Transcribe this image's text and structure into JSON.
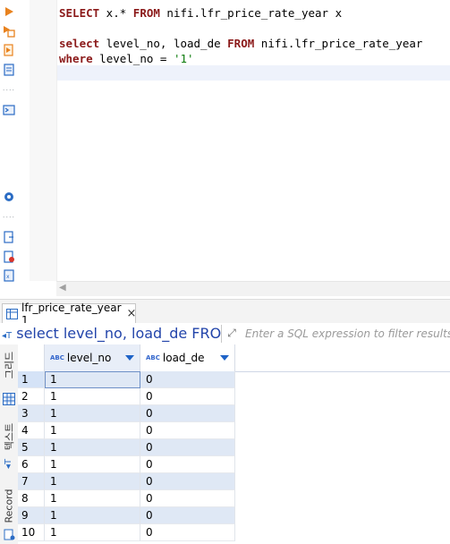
{
  "editor": {
    "lines": [
      [
        {
          "t": "SELECT",
          "k": "kw"
        },
        {
          "t": " x.* ",
          "k": ""
        },
        {
          "t": "FROM",
          "k": "kw"
        },
        {
          "t": " nifi.lfr_price_rate_year x",
          "k": ""
        }
      ],
      [],
      [
        {
          "t": "select",
          "k": "kw"
        },
        {
          "t": " level_no, load_de ",
          "k": ""
        },
        {
          "t": "FROM",
          "k": "kw"
        },
        {
          "t": " nifi.lfr_price_rate_year",
          "k": ""
        }
      ],
      [
        {
          "t": "where",
          "k": "kw"
        },
        {
          "t": " level_no = ",
          "k": ""
        },
        {
          "t": "'1'",
          "k": "str"
        }
      ],
      []
    ]
  },
  "results": {
    "tab_label": "lfr_price_rate_year 1",
    "close_glyph": "×",
    "filter_query": "select level_no, load_de FROM nifi.lfr_pric",
    "filter_placeholder": "Enter a SQL expression to filter results (use",
    "vertical_tabs": {
      "grid": "그리드",
      "text": "텍스트",
      "record": "Record"
    },
    "columns": [
      {
        "type_badge": "ABC",
        "name": "level_no"
      },
      {
        "type_badge": "ABC",
        "name": "load_de"
      }
    ],
    "rows": [
      {
        "num": "1",
        "c1": "1",
        "c2": "0"
      },
      {
        "num": "2",
        "c1": "1",
        "c2": "0"
      },
      {
        "num": "3",
        "c1": "1",
        "c2": "0"
      },
      {
        "num": "4",
        "c1": "1",
        "c2": "0"
      },
      {
        "num": "5",
        "c1": "1",
        "c2": "0"
      },
      {
        "num": "6",
        "c1": "1",
        "c2": "0"
      },
      {
        "num": "7",
        "c1": "1",
        "c2": "0"
      },
      {
        "num": "8",
        "c1": "1",
        "c2": "0"
      },
      {
        "num": "9",
        "c1": "1",
        "c2": "0"
      },
      {
        "num": "10",
        "c1": "1",
        "c2": "0"
      }
    ]
  },
  "colors": {
    "keyword": "#8b1a1a",
    "string": "#0a7a0a",
    "accent": "#1e63c7",
    "row_alt": "#dfe8f5"
  }
}
